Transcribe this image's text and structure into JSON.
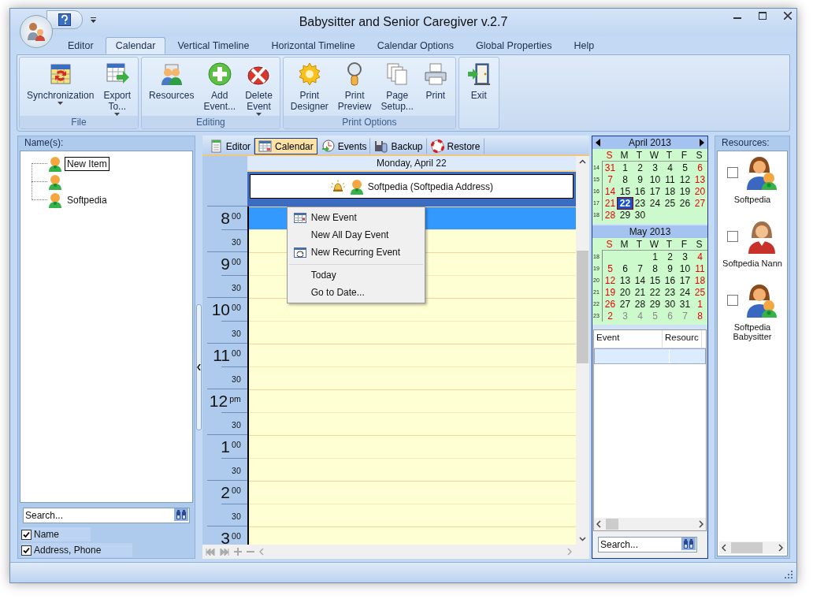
{
  "window": {
    "title": "Babysitter and Senior Caregiver v.2.7"
  },
  "ribbon_tabs": [
    {
      "label": "Editor",
      "selected": false
    },
    {
      "label": "Calendar",
      "selected": true
    },
    {
      "label": "Vertical Timeline",
      "selected": false
    },
    {
      "label": "Horizontal Timeline",
      "selected": false
    },
    {
      "label": "Calendar Options",
      "selected": false
    },
    {
      "label": "Global Properties",
      "selected": false
    },
    {
      "label": "Help",
      "selected": false
    }
  ],
  "ribbon_groups": [
    {
      "label": "File",
      "buttons": [
        {
          "label": "Synchronization",
          "dropdown": true
        },
        {
          "label": "Export To...",
          "dropdown": true
        }
      ]
    },
    {
      "label": "Editing",
      "buttons": [
        {
          "label": "Resources",
          "dropdown": false
        },
        {
          "label": "Add Event...",
          "dropdown": false
        },
        {
          "label": "Delete Event",
          "dropdown": true
        }
      ]
    },
    {
      "label": "Print Options",
      "buttons": [
        {
          "label": "Print Designer",
          "dropdown": false
        },
        {
          "label": "Print Preview",
          "dropdown": false
        },
        {
          "label": "Page Setup...",
          "dropdown": false
        },
        {
          "label": "Print",
          "dropdown": false
        }
      ]
    },
    {
      "buttons": [
        {
          "label": "Exit",
          "dropdown": false
        }
      ]
    }
  ],
  "names_panel": {
    "title": "Name(s):",
    "tree": [
      {
        "label": "New Item",
        "editing": true
      },
      {
        "editing": false
      },
      {
        "label": "Softpedia",
        "editing": false
      }
    ],
    "search": {
      "placeholder": "Search..."
    },
    "fields": [
      {
        "label": "Name",
        "checked": true
      },
      {
        "label": "Address, Phone",
        "checked": true
      }
    ]
  },
  "view_tabs": [
    {
      "label": "Editor",
      "selected": false
    },
    {
      "label": "Calendar",
      "selected": true
    },
    {
      "label": "Events",
      "selected": false
    },
    {
      "label": "Backup",
      "selected": false
    },
    {
      "label": "Restore",
      "selected": false
    }
  ],
  "day_view": {
    "date": "Monday, April 22",
    "resource": "Softpedia (Softpedia Address)",
    "hours": [
      {
        "hour": "8",
        "minute": "00",
        "half": "30",
        "selected": true
      },
      {
        "hour": "9",
        "minute": "00",
        "half": "30",
        "selected": false
      },
      {
        "hour": "10",
        "minute": "00",
        "half": "30",
        "selected": false
      },
      {
        "hour": "11",
        "minute": "00",
        "half": "30",
        "selected": false
      },
      {
        "hour": "12",
        "minute": "pm",
        "half": "30",
        "selected": false
      },
      {
        "hour": "1",
        "minute": "00",
        "half": "30",
        "selected": false
      },
      {
        "hour": "2",
        "minute": "00",
        "half": "30",
        "selected": false
      },
      {
        "hour": "3",
        "minute": "00",
        "selected": false
      }
    ]
  },
  "context_menu": [
    {
      "label": "New Event",
      "separator_before": false
    },
    {
      "label": "New All Day Event",
      "separator_before": false
    },
    {
      "label": "New Recurring Event",
      "separator_before": false
    },
    {
      "label": "Today",
      "separator_before": true
    },
    {
      "label": "Go to Date...",
      "separator_before": false
    }
  ],
  "months": [
    {
      "title": "April 2013",
      "arrows": true,
      "weekdays": [
        {
          "label": "S",
          "weekend": true
        },
        {
          "label": "M",
          "weekend": false
        },
        {
          "label": "T",
          "weekend": false
        },
        {
          "label": "W",
          "weekend": false
        },
        {
          "label": "T",
          "weekend": false
        },
        {
          "label": "F",
          "weekend": false
        },
        {
          "label": "S",
          "weekend": false
        }
      ],
      "weeks": [
        {
          "week": "14",
          "days": [
            {
              "day": "31",
              "weekend": true,
              "other_month": true,
              "selected": false
            },
            {
              "day": "1",
              "weekend": false,
              "other_month": false,
              "selected": false
            },
            {
              "day": "2",
              "weekend": false,
              "other_month": false,
              "selected": false
            },
            {
              "day": "3",
              "weekend": false,
              "other_month": false,
              "selected": false
            },
            {
              "day": "4",
              "weekend": false,
              "other_month": false,
              "selected": false
            },
            {
              "day": "5",
              "weekend": false,
              "other_month": false,
              "selected": false
            },
            {
              "day": "6",
              "weekend": true,
              "other_month": false,
              "selected": false
            }
          ]
        },
        {
          "week": "15",
          "days": [
            {
              "day": "7",
              "weekend": true,
              "other_month": false,
              "selected": false
            },
            {
              "day": "8",
              "weekend": false,
              "other_month": false,
              "selected": false
            },
            {
              "day": "9",
              "weekend": false,
              "other_month": false,
              "selected": false
            },
            {
              "day": "10",
              "weekend": false,
              "other_month": false,
              "selected": false
            },
            {
              "day": "11",
              "weekend": false,
              "other_month": false,
              "selected": false
            },
            {
              "day": "12",
              "weekend": false,
              "other_month": false,
              "selected": false
            },
            {
              "day": "13",
              "weekend": true,
              "other_month": false,
              "selected": false
            }
          ]
        },
        {
          "week": "16",
          "days": [
            {
              "day": "14",
              "weekend": true,
              "other_month": false,
              "selected": false
            },
            {
              "day": "15",
              "weekend": false,
              "other_month": false,
              "selected": false
            },
            {
              "day": "16",
              "weekend": false,
              "other_month": false,
              "selected": false
            },
            {
              "day": "17",
              "weekend": false,
              "other_month": false,
              "selected": false
            },
            {
              "day": "18",
              "weekend": false,
              "other_month": false,
              "selected": false
            },
            {
              "day": "19",
              "weekend": false,
              "other_month": false,
              "selected": false
            },
            {
              "day": "20",
              "weekend": true,
              "other_month": false,
              "selected": false
            }
          ]
        },
        {
          "week": "17",
          "days": [
            {
              "day": "21",
              "weekend": true,
              "other_month": false,
              "selected": false
            },
            {
              "day": "22",
              "weekend": false,
              "other_month": false,
              "selected": true
            },
            {
              "day": "23",
              "weekend": false,
              "other_month": false,
              "selected": false
            },
            {
              "day": "24",
              "weekend": false,
              "other_month": false,
              "selected": false
            },
            {
              "day": "25",
              "weekend": false,
              "other_month": false,
              "selected": false
            },
            {
              "day": "26",
              "weekend": false,
              "other_month": false,
              "selected": false
            },
            {
              "day": "27",
              "weekend": true,
              "other_month": false,
              "selected": false
            }
          ]
        },
        {
          "week": "18",
          "days": [
            {
              "day": "28",
              "weekend": true,
              "other_month": false,
              "selected": false
            },
            {
              "day": "29",
              "weekend": false,
              "other_month": false,
              "selected": false
            },
            {
              "day": "30",
              "weekend": false,
              "other_month": false,
              "selected": false
            }
          ]
        }
      ]
    },
    {
      "title": "May 2013",
      "arrows": false,
      "weekdays": [
        {
          "label": "S",
          "weekend": true
        },
        {
          "label": "M",
          "weekend": false
        },
        {
          "label": "T",
          "weekend": false
        },
        {
          "label": "W",
          "weekend": false
        },
        {
          "label": "T",
          "weekend": false
        },
        {
          "label": "F",
          "weekend": false
        },
        {
          "label": "S",
          "weekend": false
        }
      ],
      "weeks": [
        {
          "week": "18",
          "days": [
            {
              "day": "1",
              "weekend": false,
              "other_month": false,
              "selected": false
            },
            {
              "day": "2",
              "weekend": false,
              "other_month": false,
              "selected": false
            },
            {
              "day": "3",
              "weekend": false,
              "other_month": false,
              "selected": false
            },
            {
              "day": "4",
              "weekend": true,
              "other_month": false,
              "selected": false
            }
          ]
        },
        {
          "week": "19",
          "days": [
            {
              "day": "5",
              "weekend": true,
              "other_month": false,
              "selected": false
            },
            {
              "day": "6",
              "weekend": false,
              "other_month": false,
              "selected": false
            },
            {
              "day": "7",
              "weekend": false,
              "other_month": false,
              "selected": false
            },
            {
              "day": "8",
              "weekend": false,
              "other_month": false,
              "selected": false
            },
            {
              "day": "9",
              "weekend": false,
              "other_month": false,
              "selected": false
            },
            {
              "day": "10",
              "weekend": false,
              "other_month": false,
              "selected": false
            },
            {
              "day": "11",
              "weekend": true,
              "other_month": false,
              "selected": false
            }
          ]
        },
        {
          "week": "20",
          "days": [
            {
              "day": "12",
              "weekend": true,
              "other_month": false,
              "selected": false
            },
            {
              "day": "13",
              "weekend": false,
              "other_month": false,
              "selected": false
            },
            {
              "day": "14",
              "weekend": false,
              "other_month": false,
              "selected": false
            },
            {
              "day": "15",
              "weekend": false,
              "other_month": false,
              "selected": false
            },
            {
              "day": "16",
              "weekend": false,
              "other_month": false,
              "selected": false
            },
            {
              "day": "17",
              "weekend": false,
              "other_month": false,
              "selected": false
            },
            {
              "day": "18",
              "weekend": true,
              "other_month": false,
              "selected": false
            }
          ]
        },
        {
          "week": "21",
          "days": [
            {
              "day": "19",
              "weekend": true,
              "other_month": false,
              "selected": false
            },
            {
              "day": "20",
              "weekend": false,
              "other_month": false,
              "selected": false
            },
            {
              "day": "21",
              "weekend": false,
              "other_month": false,
              "selected": false
            },
            {
              "day": "22",
              "weekend": false,
              "other_month": false,
              "selected": false
            },
            {
              "day": "23",
              "weekend": false,
              "other_month": false,
              "selected": false
            },
            {
              "day": "24",
              "weekend": false,
              "other_month": false,
              "selected": false
            },
            {
              "day": "25",
              "weekend": true,
              "other_month": false,
              "selected": false
            }
          ]
        },
        {
          "week": "22",
          "days": [
            {
              "day": "26",
              "weekend": true,
              "other_month": false,
              "selected": false
            },
            {
              "day": "27",
              "weekend": false,
              "other_month": false,
              "selected": false
            },
            {
              "day": "28",
              "weekend": false,
              "other_month": false,
              "selected": false
            },
            {
              "day": "29",
              "weekend": false,
              "other_month": false,
              "selected": false
            },
            {
              "day": "30",
              "weekend": false,
              "other_month": false,
              "selected": false
            },
            {
              "day": "31",
              "weekend": false,
              "other_month": false,
              "selected": false
            },
            {
              "day": "1",
              "weekend": true,
              "other_month": true,
              "selected": false
            }
          ]
        },
        {
          "week": "23",
          "days": [
            {
              "day": "2",
              "weekend": true,
              "other_month": true,
              "selected": false
            },
            {
              "day": "3",
              "weekend": false,
              "other_month": true,
              "selected": false
            },
            {
              "day": "4",
              "weekend": false,
              "other_month": true,
              "selected": false
            },
            {
              "day": "5",
              "weekend": false,
              "other_month": true,
              "selected": false
            },
            {
              "day": "6",
              "weekend": false,
              "other_month": true,
              "selected": false
            },
            {
              "day": "7",
              "weekend": false,
              "other_month": true,
              "selected": false
            },
            {
              "day": "8",
              "weekend": true,
              "other_month": true,
              "selected": false
            }
          ]
        }
      ]
    }
  ],
  "events_table": {
    "columns": [
      "Event",
      "Resourc"
    ],
    "rows": [
      {
        "selected": true
      }
    ],
    "search": {
      "placeholder": "Search..."
    }
  },
  "resources_panel": {
    "title": "Resources:",
    "items": [
      {
        "name": "Softpedia",
        "checked": false
      },
      {
        "name": "Softpedia Nann",
        "checked": false
      },
      {
        "name": "Softpedia Babysitter",
        "checked": false
      }
    ]
  }
}
